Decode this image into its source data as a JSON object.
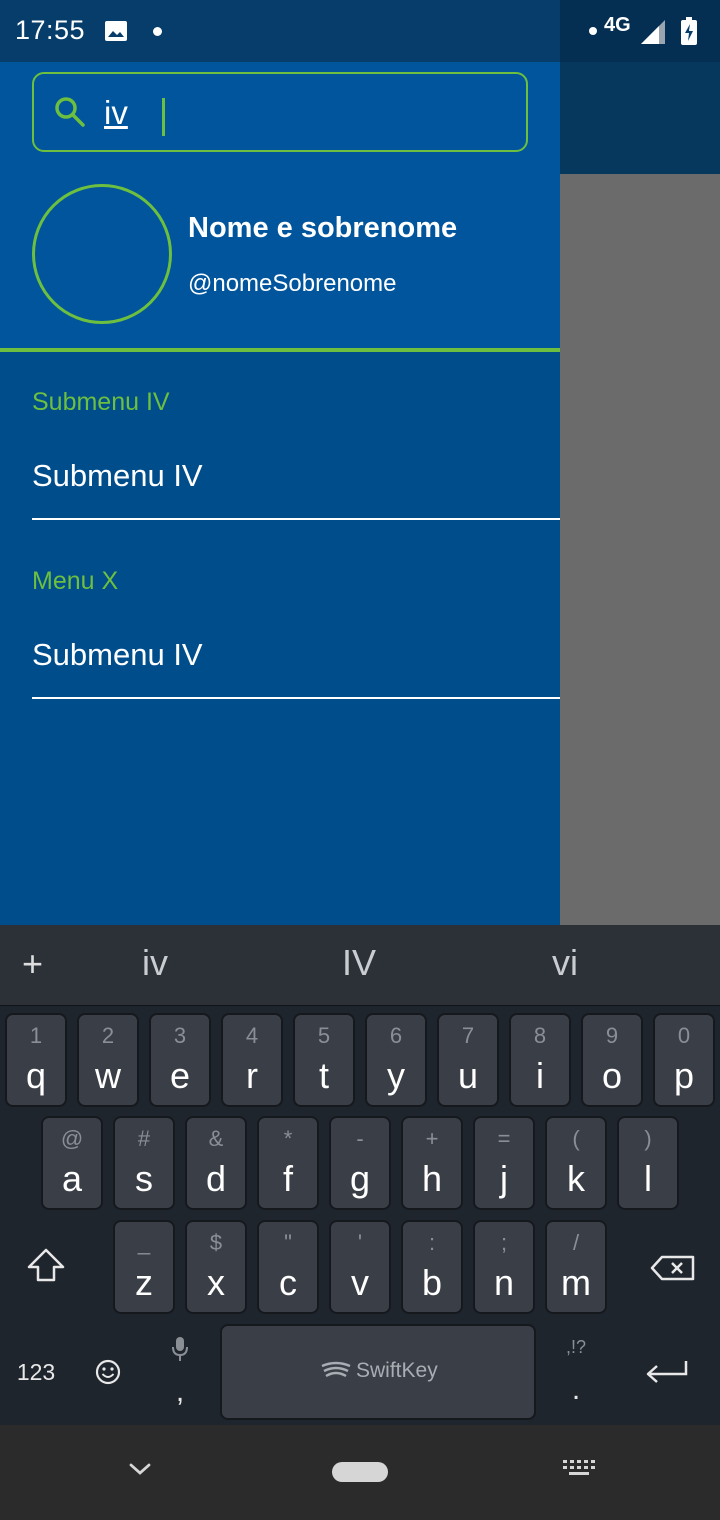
{
  "status_bar": {
    "time": "17:55",
    "network": "4G",
    "icons": [
      "image-icon",
      "notification-dot",
      "signal-icon",
      "battery-charging-icon"
    ]
  },
  "drawer": {
    "search": {
      "value": "iv",
      "icon": "search-icon"
    },
    "profile": {
      "name": "Nome e sobrenome",
      "handle": "@nomeSobrenome"
    },
    "sections": [
      {
        "title": "Submenu IV",
        "items": [
          "Submenu IV"
        ]
      },
      {
        "title": "Menu X",
        "items": [
          "Submenu IV"
        ]
      }
    ]
  },
  "keyboard": {
    "suggestions": [
      "iv",
      "IV",
      "vi"
    ],
    "row1": [
      {
        "sub": "1",
        "main": "q"
      },
      {
        "sub": "2",
        "main": "w"
      },
      {
        "sub": "3",
        "main": "e"
      },
      {
        "sub": "4",
        "main": "r"
      },
      {
        "sub": "5",
        "main": "t"
      },
      {
        "sub": "6",
        "main": "y"
      },
      {
        "sub": "7",
        "main": "u"
      },
      {
        "sub": "8",
        "main": "i"
      },
      {
        "sub": "9",
        "main": "o"
      },
      {
        "sub": "0",
        "main": "p"
      }
    ],
    "row2": [
      {
        "sub": "@",
        "main": "a"
      },
      {
        "sub": "#",
        "main": "s"
      },
      {
        "sub": "&",
        "main": "d"
      },
      {
        "sub": "*",
        "main": "f"
      },
      {
        "sub": "-",
        "main": "g"
      },
      {
        "sub": "+",
        "main": "h"
      },
      {
        "sub": "=",
        "main": "j"
      },
      {
        "sub": "(",
        "main": "k"
      },
      {
        "sub": ")",
        "main": "l"
      }
    ],
    "row3": [
      {
        "sub": "_",
        "main": "z"
      },
      {
        "sub": "$",
        "main": "x"
      },
      {
        "sub": "\"",
        "main": "c"
      },
      {
        "sub": "'",
        "main": "v"
      },
      {
        "sub": ":",
        "main": "b"
      },
      {
        "sub": ";",
        "main": "n"
      },
      {
        "sub": "/",
        "main": "m"
      }
    ],
    "bottom": {
      "numbers_label": "123",
      "comma": ",",
      "space_label": "SwiftKey",
      "period_sub": ",!?",
      "period": "."
    }
  },
  "colors": {
    "drawer": "#004d8c",
    "drawer_header": "#00559c",
    "accent_green": "#6cbf3f",
    "scrim": "#6b6b6b",
    "keyboard": "#1f252d",
    "key": "#3a3f47"
  }
}
